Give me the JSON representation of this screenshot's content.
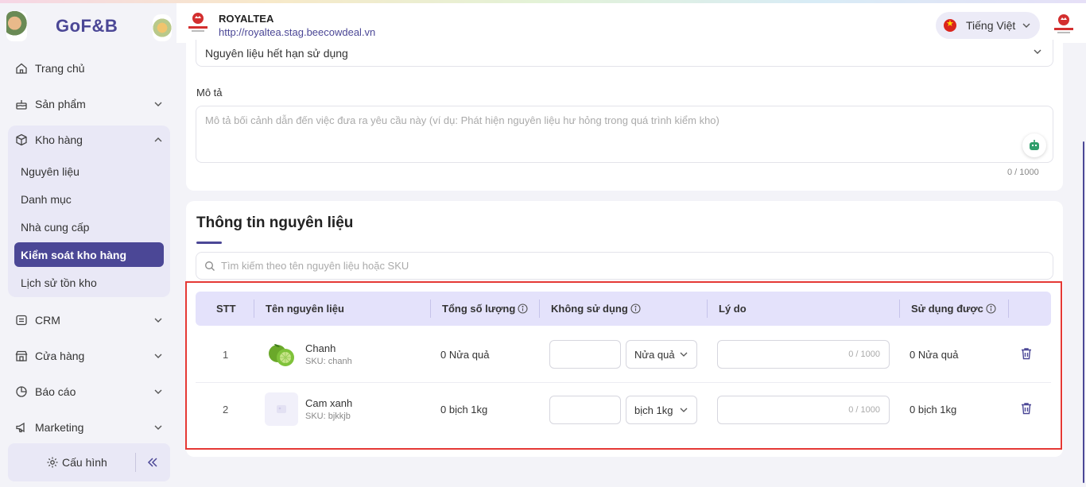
{
  "brand": {
    "name": "GoF&B"
  },
  "sidebar": {
    "items": [
      {
        "label": "Trang chủ",
        "icon": "home-icon"
      },
      {
        "label": "Sản phẩm",
        "icon": "cake-icon"
      },
      {
        "label": "Kho hàng",
        "icon": "box-icon"
      },
      {
        "label": "CRM",
        "icon": "crm-icon"
      },
      {
        "label": "Cửa hàng",
        "icon": "store-icon"
      },
      {
        "label": "Báo cáo",
        "icon": "chart-icon"
      },
      {
        "label": "Marketing",
        "icon": "megaphone-icon"
      }
    ],
    "kho_sub": [
      {
        "label": "Nguyên liệu"
      },
      {
        "label": "Danh mục"
      },
      {
        "label": "Nhà cung cấp"
      },
      {
        "label": "Kiểm soát kho hàng"
      },
      {
        "label": "Lịch sử tồn kho"
      }
    ],
    "config_label": "Cấu hình"
  },
  "header": {
    "store_name": "ROYALTEA",
    "store_url": "http://royaltea.stag.beecowdeal.vn",
    "language": "Tiếng Việt"
  },
  "form": {
    "reason_select_value": "Nguyên liệu hết hạn sử dụng",
    "description_label": "Mô tả",
    "description_placeholder": "Mô tả bối cảnh dẫn đến việc đưa ra yêu cầu này (ví dụ: Phát hiện nguyên liệu hư hỏng trong quá trình kiểm kho)",
    "description_counter": "0 / 1000"
  },
  "materials": {
    "title": "Thông tin nguyên liệu",
    "search_placeholder": "Tìm kiếm theo tên nguyên liệu hoặc SKU",
    "columns": [
      "STT",
      "Tên nguyên liệu",
      "Tổng số lượng",
      "Không sử dụng",
      "Lý do",
      "Sử dụng được"
    ],
    "rows": [
      {
        "stt": "1",
        "name": "Chanh",
        "sku": "SKU: chanh",
        "total": "0 Nửa quả",
        "unused": "",
        "unit": "Nửa quả",
        "reason_counter": "0 / 1000",
        "usable": "0 Nửa quả"
      },
      {
        "stt": "2",
        "name": "Cam xanh",
        "sku": "SKU: bjkkjb",
        "total": "0 bịch 1kg",
        "unused": "",
        "unit": "bịch 1kg",
        "reason_counter": "0 / 1000",
        "usable": "0 bịch 1kg"
      }
    ]
  },
  "colors": {
    "primary": "#4b4796",
    "table_header": "#e4e2fb",
    "highlight": "#e53935"
  }
}
